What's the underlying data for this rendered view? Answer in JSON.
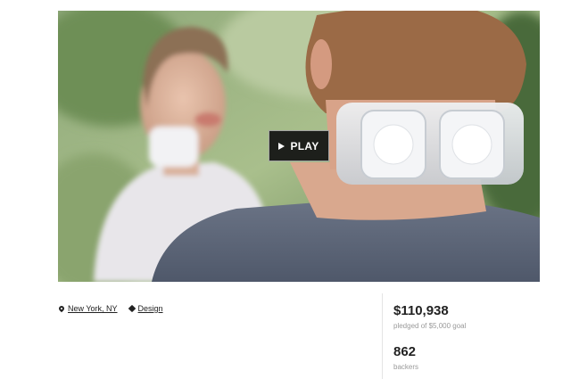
{
  "video": {
    "play_label": "PLAY",
    "play_icon": "play-icon"
  },
  "meta": {
    "location": "New York, NY",
    "location_icon": "map-pin-icon",
    "category": "Design",
    "category_icon": "tag-icon"
  },
  "stats": {
    "pledged_amount": "$110,938",
    "pledged_label": "pledged of $5,000 goal",
    "backers_count": "862",
    "backers_label": "backers"
  },
  "colors": {
    "text": "#222222",
    "muted": "#9a9a9a",
    "play_bg": "#111111"
  }
}
